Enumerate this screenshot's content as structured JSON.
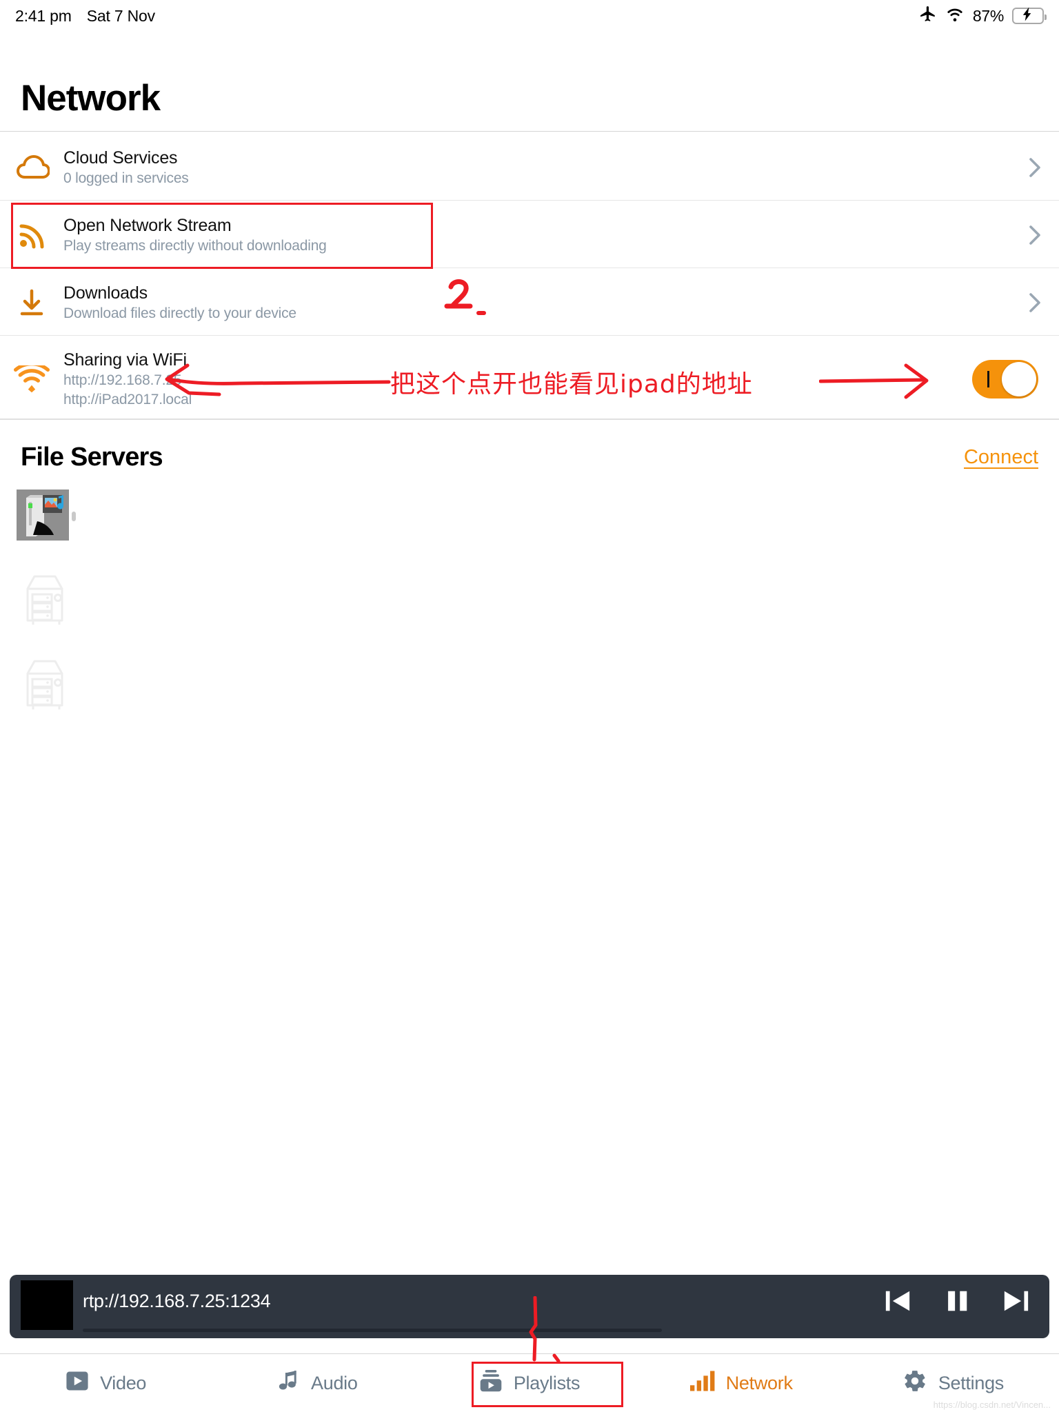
{
  "statusbar": {
    "time": "2:41 pm",
    "date": "Sat 7 Nov",
    "battery_percent": "87%",
    "icons": [
      "airplane-mode-icon",
      "wifi-icon",
      "battery-charging-icon"
    ]
  },
  "header": {
    "title": "Network"
  },
  "rows": [
    {
      "icon": "cloud-icon",
      "title": "Cloud Services",
      "subtitle": "0 logged in services",
      "accessory": "chevron-right-icon"
    },
    {
      "icon": "rss-stream-icon",
      "title": "Open Network Stream",
      "subtitle": "Play streams directly without downloading",
      "accessory": "chevron-right-icon"
    },
    {
      "icon": "download-icon",
      "title": "Downloads",
      "subtitle": "Download files directly to your device",
      "accessory": "chevron-right-icon"
    },
    {
      "icon": "wifi-sharing-icon",
      "title": "Sharing via WiFi",
      "subtitle": "http://192.168.7.25",
      "subtitle2": "http://iPad2017.local",
      "accessory": "toggle-switch",
      "toggle_state": "on"
    }
  ],
  "file_servers": {
    "title": "File Servers",
    "connect_label": "Connect",
    "items": [
      {
        "icon": "media-server-thumbnail",
        "label": ""
      },
      {
        "icon": "server-placeholder-icon",
        "label": ""
      },
      {
        "icon": "server-placeholder-icon",
        "label": ""
      }
    ]
  },
  "player": {
    "title": "rtp://192.168.7.25:1234",
    "artwork": "black-artwork-placeholder",
    "controls": [
      "previous-track-icon",
      "pause-icon",
      "next-track-icon"
    ],
    "progress_percent": 0
  },
  "tabbar": {
    "tabs": [
      {
        "icon": "video-icon",
        "label": "Video",
        "active": false
      },
      {
        "icon": "audio-note-icon",
        "label": "Audio",
        "active": false
      },
      {
        "icon": "playlists-icon",
        "label": "Playlists",
        "active": false
      },
      {
        "icon": "network-bars-icon",
        "label": "Network",
        "active": true
      },
      {
        "icon": "gear-icon",
        "label": "Settings",
        "active": false
      }
    ]
  },
  "annotations": {
    "step_two": "2",
    "note_cn": "把这个点开也能看见ipad的地址",
    "color": "#ed1c24"
  },
  "colors": {
    "accent_orange": "#f5920b",
    "accent_orange_dark": "#e07b16",
    "subtitle_gray": "#8b98a5",
    "player_bg": "#2f3640",
    "annotation_red": "#ed1c24",
    "tab_active_bg": "#fbe9d5"
  },
  "watermark": "https://blog.csdn.net/Vincen..."
}
